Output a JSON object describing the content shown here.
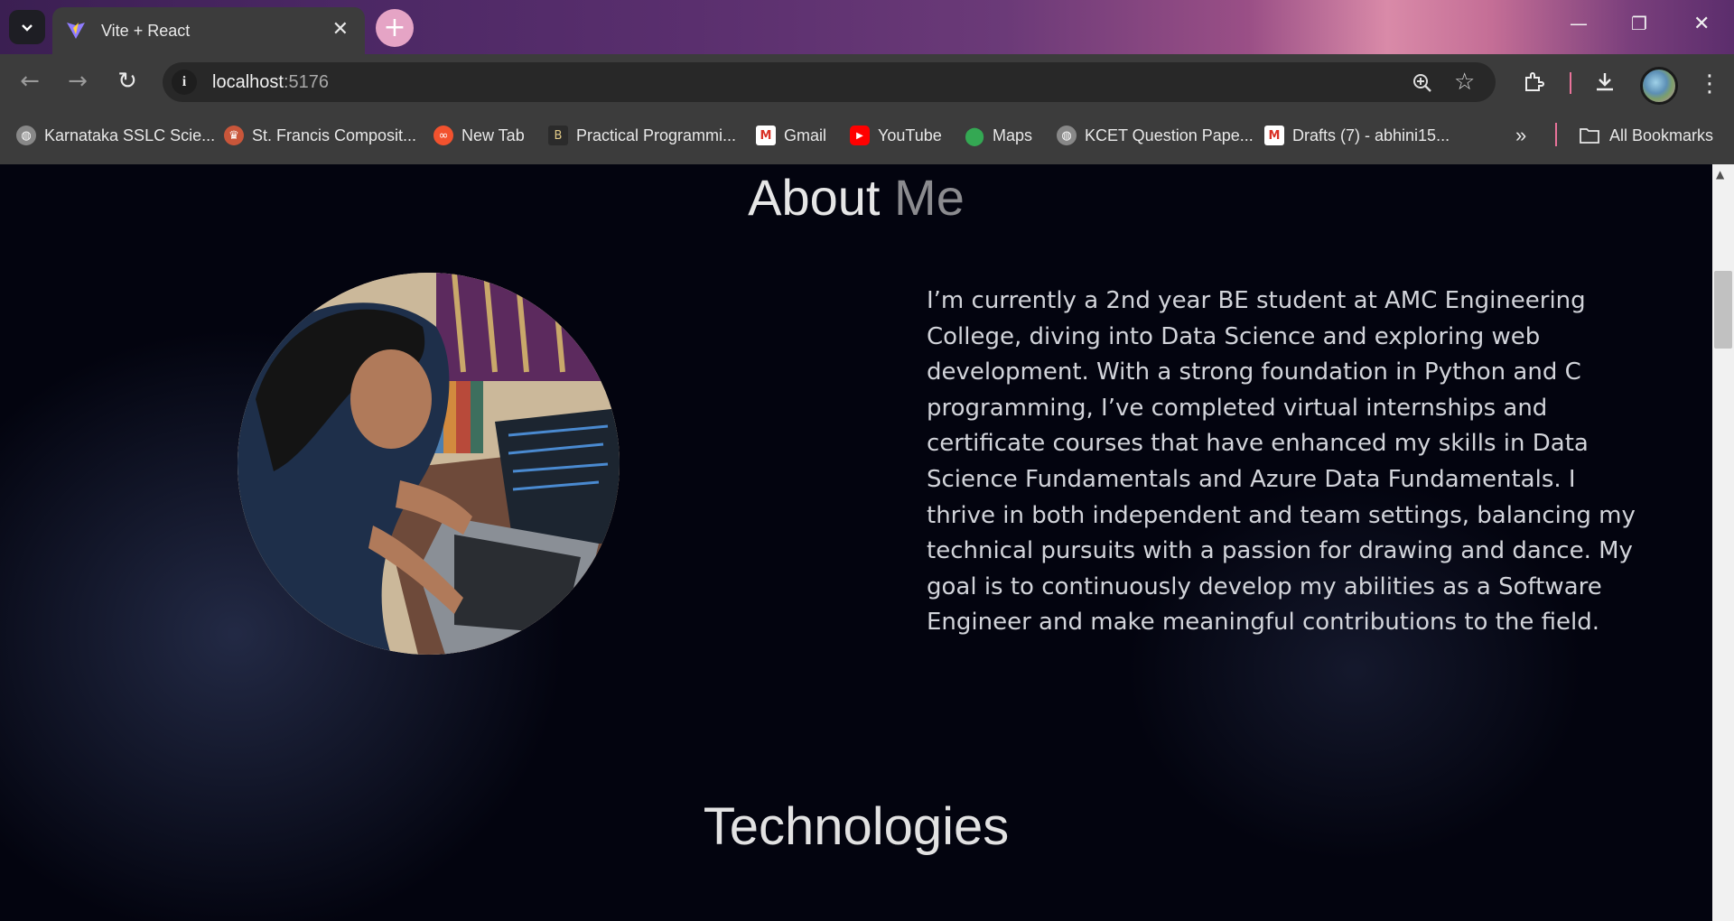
{
  "browser": {
    "tab_title": "Vite + React",
    "url_host": "localhost",
    "url_port": ":5176",
    "bookmarks": [
      {
        "label": "Karnataka SSLC Scie...",
        "icon": "globe-icon"
      },
      {
        "label": "St. Francis Composit...",
        "icon": "school-crest-icon"
      },
      {
        "label": "New Tab",
        "icon": "infinity-icon"
      },
      {
        "label": "Practical Programmi...",
        "icon": "book-icon"
      },
      {
        "label": "Gmail",
        "icon": "gmail-icon"
      },
      {
        "label": "YouTube",
        "icon": "youtube-icon"
      },
      {
        "label": "Maps",
        "icon": "maps-pin-icon"
      },
      {
        "label": "KCET Question Pape...",
        "icon": "globe-icon"
      },
      {
        "label": "Drafts (7) - abhini15...",
        "icon": "gmail-icon"
      }
    ],
    "all_bookmarks": "All Bookmarks"
  },
  "page": {
    "about_heading_main": "About",
    "about_heading_muted": "Me",
    "about_paragraph": "I’m currently a 2nd year BE student at AMC Engineering College, diving into Data Science and exploring web development. With a strong foundation in Python and C programming, I’ve completed virtual internships and certificate courses that have enhanced my skills in Data Science Fundamentals and Azure Data Fundamentals. I thrive in both independent and team settings, balancing my technical pursuits with a passion for drawing and dance. My goal is to continuously develop my abilities as a Software Engineer and make meaningful contributions to the field.",
    "technologies_heading": "Technologies"
  },
  "colors": {
    "page_background": "#03040f",
    "accent_pink": "#e5a4c5",
    "text_light": "#d2d4da"
  }
}
